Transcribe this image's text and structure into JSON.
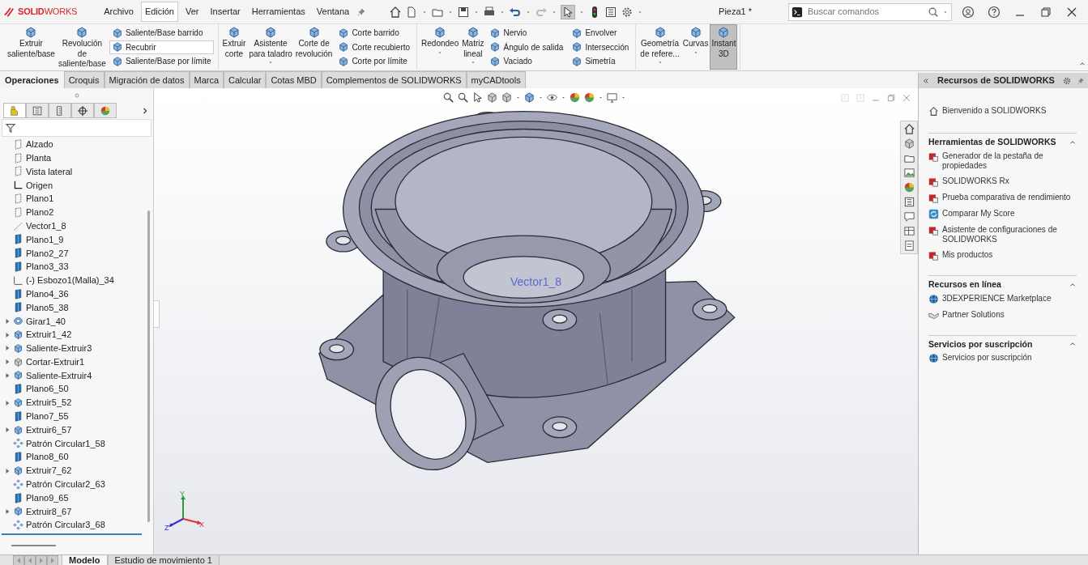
{
  "app": {
    "logo": "**SOLID**WORKS",
    "document_title": "Pieza1 *"
  },
  "menu": [
    {
      "label": "Archivo",
      "selected": false
    },
    {
      "label": "Edición",
      "selected": true
    },
    {
      "label": "Ver",
      "selected": false
    },
    {
      "label": "Insertar",
      "selected": false
    },
    {
      "label": "Herramientas",
      "selected": false
    },
    {
      "label": "Ventana",
      "selected": false
    }
  ],
  "search": {
    "placeholder": "Buscar comandos"
  },
  "ribbon": [
    {
      "items": [
        {
          "kind": "large",
          "label": "Extruir\nsaliente/base",
          "dropdown": false,
          "pressed": false
        },
        {
          "kind": "large",
          "label": "Revolución\nde\nsaliente/base",
          "dropdown": false,
          "pressed": false
        },
        {
          "kind": "stack",
          "entries": [
            {
              "label": "Saliente/Base barrido",
              "selected": false
            },
            {
              "label": "Recubrir",
              "selected": true
            },
            {
              "label": "Saliente/Base por límite",
              "selected": false
            }
          ]
        }
      ]
    },
    {
      "items": [
        {
          "kind": "large",
          "label": "Extruir\ncorte",
          "dropdown": false,
          "pressed": false
        },
        {
          "kind": "large",
          "label": "Asistente\npara taladro",
          "dropdown": true,
          "pressed": false
        },
        {
          "kind": "large",
          "label": "Corte de\nrevolución",
          "dropdown": false,
          "pressed": false
        },
        {
          "kind": "stack",
          "entries": [
            {
              "label": "Corte barrido",
              "selected": false
            },
            {
              "label": "Corte recubierto",
              "selected": false
            },
            {
              "label": "Corte por límite",
              "selected": false
            }
          ]
        }
      ]
    },
    {
      "items": [
        {
          "kind": "large",
          "label": "Redondeo",
          "dropdown": true,
          "pressed": false
        },
        {
          "kind": "large",
          "label": "Matriz\nlineal",
          "dropdown": true,
          "pressed": false
        },
        {
          "kind": "stack",
          "entries": [
            {
              "label": "Nervio",
              "selected": false
            },
            {
              "label": "Ángulo de salida",
              "selected": false
            },
            {
              "label": "Vaciado",
              "selected": false
            }
          ]
        },
        {
          "kind": "stack",
          "entries": [
            {
              "label": "Envolver",
              "selected": false
            },
            {
              "label": "Intersección",
              "selected": false
            },
            {
              "label": "Simetría",
              "selected": false
            }
          ]
        }
      ]
    },
    {
      "items": [
        {
          "kind": "large",
          "label": "Geometría\nde refere...",
          "dropdown": true,
          "pressed": false
        },
        {
          "kind": "large",
          "label": "Curvas",
          "dropdown": true,
          "pressed": false
        },
        {
          "kind": "large",
          "label": "Instant\n3D",
          "dropdown": false,
          "pressed": true
        }
      ]
    }
  ],
  "tabs": [
    {
      "label": "Operaciones",
      "selected": true
    },
    {
      "label": "Croquis",
      "selected": false
    },
    {
      "label": "Migración de datos",
      "selected": false
    },
    {
      "label": "Marca",
      "selected": false
    },
    {
      "label": "Calcular",
      "selected": false
    },
    {
      "label": "Cotas MBD",
      "selected": false
    },
    {
      "label": "Complementos de SOLIDWORKS",
      "selected": false
    },
    {
      "label": "myCADtools",
      "selected": false
    }
  ],
  "panel_tabs": [
    {
      "selected": true
    },
    {
      "selected": false
    },
    {
      "selected": false
    },
    {
      "selected": false
    },
    {
      "selected": false
    }
  ],
  "tree": [
    {
      "label": "Alzado",
      "kind": "plane",
      "expandable": false
    },
    {
      "label": "Planta",
      "kind": "plane",
      "expandable": false
    },
    {
      "label": "Vista lateral",
      "kind": "plane",
      "expandable": false
    },
    {
      "label": "Origen",
      "kind": "origin",
      "expandable": false
    },
    {
      "label": "Plano1",
      "kind": "plane",
      "expandable": false
    },
    {
      "label": "Plano2",
      "kind": "plane",
      "expandable": false
    },
    {
      "label": "Vector1_8",
      "kind": "axis",
      "expandable": false
    },
    {
      "label": "Plano1_9",
      "kind": "solid-plane",
      "expandable": false
    },
    {
      "label": "Plano2_27",
      "kind": "solid-plane",
      "expandable": false
    },
    {
      "label": "Plano3_33",
      "kind": "solid-plane",
      "expandable": false
    },
    {
      "label": "(-) Esbozo1(Malla)_34",
      "kind": "sketch",
      "expandable": false
    },
    {
      "label": "Plano4_36",
      "kind": "solid-plane",
      "expandable": false
    },
    {
      "label": "Plano5_38",
      "kind": "solid-plane",
      "expandable": false
    },
    {
      "label": "Girar1_40",
      "kind": "revolve",
      "expandable": true
    },
    {
      "label": "Extruir1_42",
      "kind": "extrude",
      "expandable": true
    },
    {
      "label": "Saliente-Extruir3",
      "kind": "extrude",
      "expandable": true
    },
    {
      "label": "Cortar-Extruir1",
      "kind": "cut",
      "expandable": true
    },
    {
      "label": "Saliente-Extruir4",
      "kind": "extrude",
      "expandable": true
    },
    {
      "label": "Plano6_50",
      "kind": "solid-plane",
      "expandable": false
    },
    {
      "label": "Extruir5_52",
      "kind": "extrude",
      "expandable": true
    },
    {
      "label": "Plano7_55",
      "kind": "solid-plane",
      "expandable": false
    },
    {
      "label": "Extruir6_57",
      "kind": "extrude",
      "expandable": true
    },
    {
      "label": "Patrón Circular1_58",
      "kind": "pattern",
      "expandable": false
    },
    {
      "label": "Plano8_60",
      "kind": "solid-plane",
      "expandable": false
    },
    {
      "label": "Extruir7_62",
      "kind": "extrude",
      "expandable": true
    },
    {
      "label": "Patrón Circular2_63",
      "kind": "pattern",
      "expandable": false
    },
    {
      "label": "Plano9_65",
      "kind": "solid-plane",
      "expandable": false
    },
    {
      "label": "Extruir8_67",
      "kind": "extrude",
      "expandable": true
    },
    {
      "label": "Patrón Circular3_68",
      "kind": "pattern",
      "expandable": false
    }
  ],
  "viewport": {
    "vector_label": "Vector1_8",
    "triad": {
      "x": "X",
      "y": "Y",
      "z": "Z"
    }
  },
  "task_pane": {
    "title": "Recursos de SOLIDWORKS",
    "welcome": "Bienvenido a SOLIDWORKS",
    "sections": [
      {
        "title": "Herramientas de SOLIDWORKS",
        "expanded": true,
        "items": [
          "Generador de la pestaña de propiedades",
          "SOLIDWORKS Rx",
          "Prueba comparativa de rendimiento",
          "Comparar My Score",
          "Asistente de configuraciones de SOLIDWORKS",
          "Mis productos"
        ]
      },
      {
        "title": "Recursos en línea",
        "expanded": true,
        "items": [
          "3DEXPERIENCE Marketplace",
          "Partner Solutions"
        ]
      },
      {
        "title": "Servicios por suscripción",
        "expanded": true,
        "items": [
          "Servicios por suscripción"
        ]
      }
    ]
  },
  "bottom_tabs": [
    {
      "label": "Modelo",
      "selected": true
    },
    {
      "label": "Estudio de movimiento 1",
      "selected": false
    }
  ]
}
